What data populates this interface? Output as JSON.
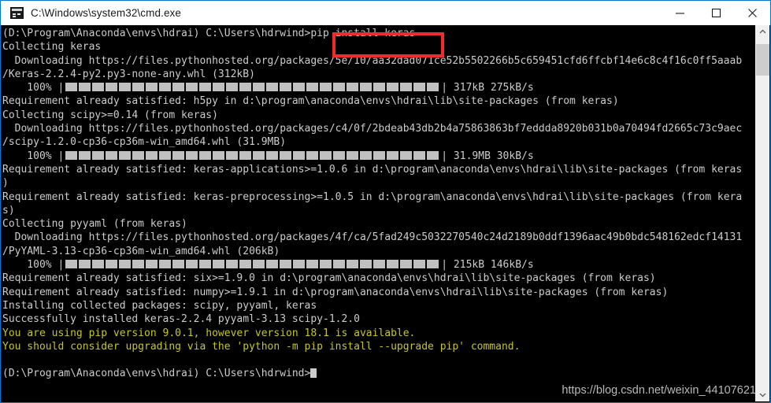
{
  "titlebar": {
    "title": "C:\\Windows\\system32\\cmd.exe",
    "icon": "console-icon",
    "minimize_label": "—",
    "maximize_label": "□",
    "close_label": "✕"
  },
  "terminal": {
    "prompt_prefix": "(D:\\Program\\Anaconda\\envs\\hdrai) C:\\Users\\hdrwind>",
    "command": "pip install keras",
    "highlight_color": "#ef2b2b",
    "text_color": "#cccccc",
    "warning_color": "#c5c527",
    "background": "#000000",
    "lines": [
      {
        "id": "l1",
        "text": "(D:\\Program\\Anaconda\\envs\\hdrai) C:\\Users\\hdrwind>pip install keras",
        "color": "normal"
      },
      {
        "id": "l2",
        "text": "Collecting keras",
        "color": "normal"
      },
      {
        "id": "l3",
        "text": "  Downloading https://files.pythonhosted.org/packages/5e/10/aa32dad071ce52b5502266b5c659451cfd6ffcbf14e6c8c4f16c0ff5aaab",
        "color": "normal"
      },
      {
        "id": "l4",
        "text": "/Keras-2.2.4-py2.py3-none-any.whl (312kB)",
        "color": "normal"
      },
      {
        "id": "l5",
        "type": "progress",
        "percent": "100%",
        "size": "317kB",
        "speed": "275kB/s",
        "color": "normal"
      },
      {
        "id": "l6",
        "text": "Requirement already satisfied: h5py in d:\\program\\anaconda\\envs\\hdrai\\lib\\site-packages (from keras)",
        "color": "normal"
      },
      {
        "id": "l7",
        "text": "Collecting scipy>=0.14 (from keras)",
        "color": "normal"
      },
      {
        "id": "l8",
        "text": "  Downloading https://files.pythonhosted.org/packages/c4/0f/2bdeab43db2b4a75863863bf7eddda8920b031b0a70494fd2665c73c9aec",
        "color": "normal"
      },
      {
        "id": "l9",
        "text": "/scipy-1.2.0-cp36-cp36m-win_amd64.whl (31.9MB)",
        "color": "normal"
      },
      {
        "id": "l10",
        "type": "progress",
        "percent": "100%",
        "size": "31.9MB",
        "speed": "30kB/s",
        "color": "normal"
      },
      {
        "id": "l11",
        "text": "Requirement already satisfied: keras-applications>=1.0.6 in d:\\program\\anaconda\\envs\\hdrai\\lib\\site-packages (from keras",
        "color": "normal"
      },
      {
        "id": "l12",
        "text": ")",
        "color": "normal"
      },
      {
        "id": "l13",
        "text": "Requirement already satisfied: keras-preprocessing>=1.0.5 in d:\\program\\anaconda\\envs\\hdrai\\lib\\site-packages (from kera",
        "color": "normal"
      },
      {
        "id": "l14",
        "text": "s)",
        "color": "normal"
      },
      {
        "id": "l15",
        "text": "Collecting pyyaml (from keras)",
        "color": "normal"
      },
      {
        "id": "l16",
        "text": "  Downloading https://files.pythonhosted.org/packages/4f/ca/5fad249c5032270540c24d2189b0ddf1396aac49b0bdc548162edcf14131",
        "color": "normal"
      },
      {
        "id": "l17",
        "text": "/PyYAML-3.13-cp36-cp36m-win_amd64.whl (206kB)",
        "color": "normal"
      },
      {
        "id": "l18",
        "type": "progress",
        "percent": "100%",
        "size": "215kB",
        "speed": "146kB/s",
        "color": "normal"
      },
      {
        "id": "l19",
        "text": "Requirement already satisfied: six>=1.9.0 in d:\\program\\anaconda\\envs\\hdrai\\lib\\site-packages (from keras)",
        "color": "normal"
      },
      {
        "id": "l20",
        "text": "Requirement already satisfied: numpy>=1.9.1 in d:\\program\\anaconda\\envs\\hdrai\\lib\\site-packages (from keras)",
        "color": "normal"
      },
      {
        "id": "l21",
        "text": "Installing collected packages: scipy, pyyaml, keras",
        "color": "normal"
      },
      {
        "id": "l22",
        "text": "Successfully installed keras-2.2.4 pyyaml-3.13 scipy-1.2.0",
        "color": "normal"
      },
      {
        "id": "l23",
        "text": "You are using pip version 9.0.1, however version 18.1 is available.",
        "color": "warning"
      },
      {
        "id": "l24",
        "text": "You should consider upgrading via the 'python -m pip install --upgrade pip' command.",
        "color": "warning"
      },
      {
        "id": "l25",
        "text": "",
        "color": "normal"
      },
      {
        "id": "l26",
        "text": "(D:\\Program\\Anaconda\\envs\\hdrai) C:\\Users\\hdrwind>",
        "color": "normal",
        "cursor": true
      }
    ]
  },
  "watermark": {
    "text": "https://blog.csdn.net/weixin_44107621"
  },
  "scrollbar": {
    "up_arrow": "∧",
    "down_arrow": "∨"
  }
}
